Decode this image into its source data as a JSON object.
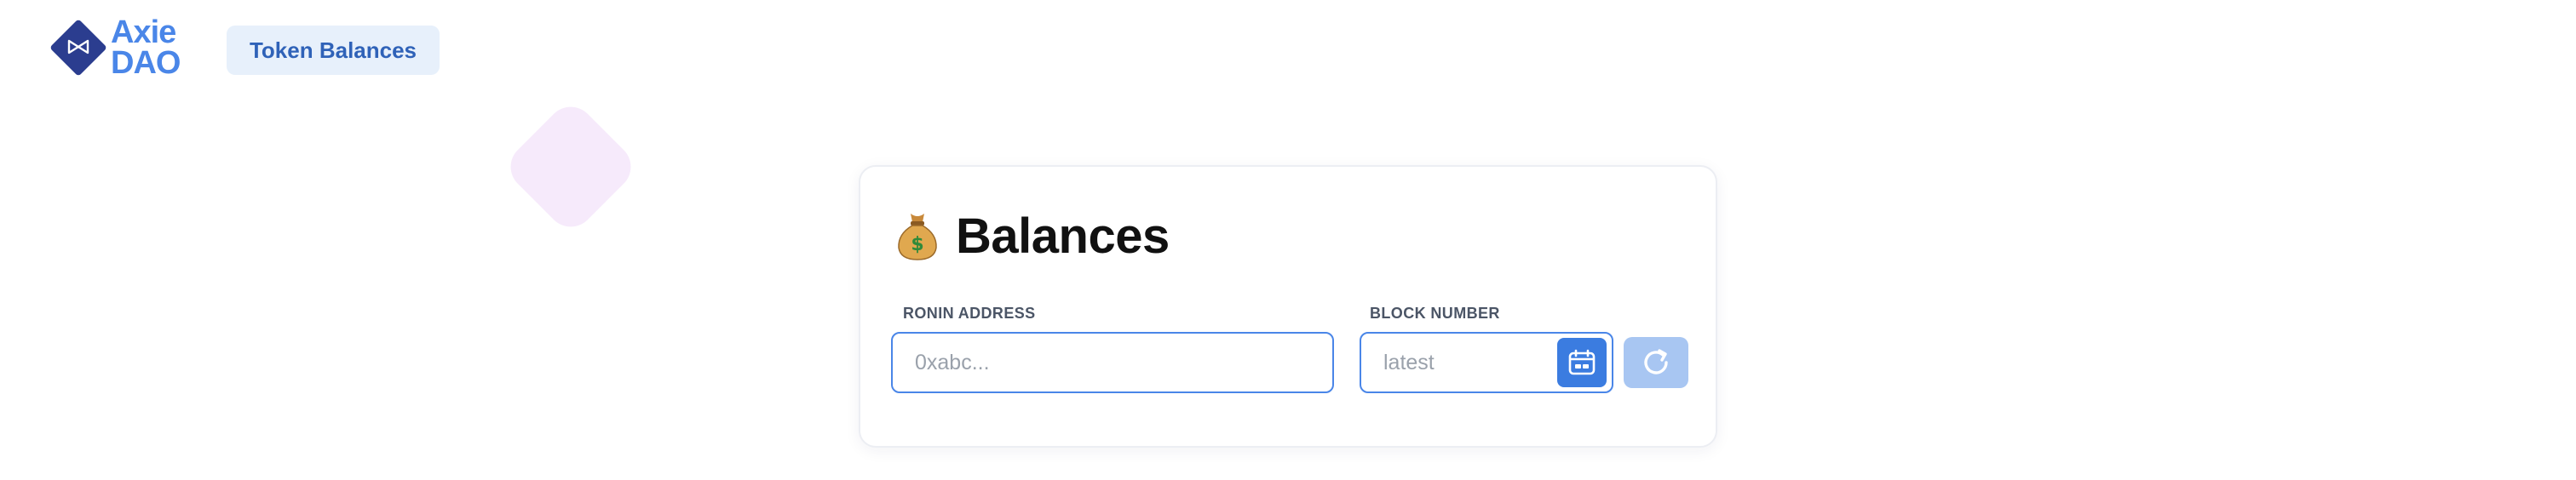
{
  "brand": {
    "line1": "Axie",
    "line2": "DAO",
    "logo_icon": "axie-emblem-icon"
  },
  "nav": {
    "tabs": [
      {
        "label": "Token Balances",
        "active": true
      }
    ]
  },
  "card": {
    "title": "Balances",
    "title_emoji": "money-bag-icon",
    "fields": {
      "ronin_address": {
        "label": "RONIN ADDRESS",
        "placeholder": "0xabc...",
        "value": ""
      },
      "block_number": {
        "label": "BLOCK NUMBER",
        "placeholder": "latest",
        "value": ""
      }
    },
    "buttons": {
      "calendar_icon": "calendar-icon",
      "refresh_icon": "refresh-icon",
      "refresh_enabled": false
    }
  },
  "colors": {
    "accent": "#4a86e8",
    "brand_dark": "#2b3d8f",
    "tab_bg": "#e7f0fb",
    "tab_text": "#2f62b8",
    "disabled_button": "#a8c6f2",
    "deco": "#f6eafb"
  }
}
